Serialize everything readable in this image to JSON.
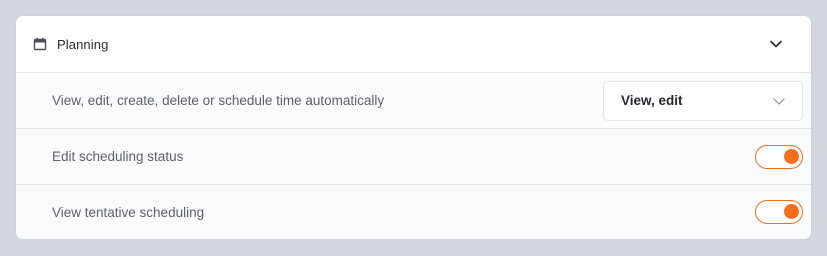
{
  "section": {
    "title": "Planning",
    "icon": "calendar-icon",
    "expanded": true,
    "collapse_icon": "chevron-down-icon"
  },
  "permissions": [
    {
      "label": "View, edit, create, delete or schedule time automatically",
      "control": "select",
      "value": "View, edit",
      "icon": "chevron-down-icon"
    },
    {
      "label": "Edit scheduling status",
      "control": "toggle",
      "enabled": true
    },
    {
      "label": "View tentative scheduling",
      "control": "toggle",
      "enabled": true
    }
  ],
  "colors": {
    "accent": "#f46f1b",
    "background": "#d3d7e0",
    "card": "#ffffff",
    "row": "#fafbfc"
  }
}
